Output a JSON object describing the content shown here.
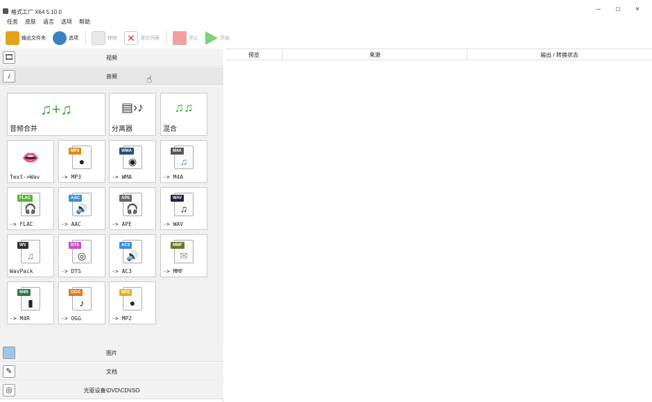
{
  "window": {
    "title": "格式工厂 X64 5.10.0",
    "controls": {
      "minimize": "–",
      "maximize": "□",
      "close": "×"
    }
  },
  "menu": [
    "任务",
    "皮肤",
    "语言",
    "选项",
    "帮助"
  ],
  "toolbar": {
    "output_folder": "输出文件夹",
    "options": "选项",
    "remove": "移除",
    "clear_list": "清空列表",
    "stop": "停止",
    "start": "开始"
  },
  "categories": {
    "video": "视频",
    "audio": "音频",
    "image": "图片",
    "document": "文档",
    "disc": "光驱设备\\DVD\\CD\\ISO"
  },
  "audio_tools": {
    "big": [
      {
        "label": "音频合并",
        "icon": "audio-merge-icon"
      },
      {
        "label": "分离器",
        "icon": "splitter-icon"
      },
      {
        "label": "混合",
        "icon": "mix-icon"
      }
    ],
    "rows": [
      [
        {
          "label": "Text->Wav",
          "badge": ""
        },
        {
          "label": "-> MP3",
          "badge": "MP3"
        },
        {
          "label": "-> WMA",
          "badge": "WMA"
        },
        {
          "label": "-> M4A",
          "badge": "M4A"
        }
      ],
      [
        {
          "label": "-> FLAC",
          "badge": "FLAC"
        },
        {
          "label": "-> AAC",
          "badge": "AAC"
        },
        {
          "label": "-> APE",
          "badge": "APE"
        },
        {
          "label": "-> WAV",
          "badge": "WAV"
        }
      ],
      [
        {
          "label": "WavPack",
          "badge": "WV"
        },
        {
          "label": "-> DTS",
          "badge": "DTS"
        },
        {
          "label": "-> AC3",
          "badge": "AC3"
        },
        {
          "label": "-> MMF",
          "badge": "MMF"
        }
      ],
      [
        {
          "label": "-> M4R",
          "badge": "M4R"
        },
        {
          "label": "-> OGG",
          "badge": "OGG"
        },
        {
          "label": "-> MP2",
          "badge": "MP2"
        }
      ]
    ],
    "badge_colors": {
      "MP3": "#e08a1a",
      "WMA": "#2a4f7a",
      "M4A": "#555555",
      "FLAC": "#55b82e",
      "AAC": "#3b8fd8",
      "APE": "#666666",
      "WAV": "#222244",
      "WV": "#333333",
      "DTS": "#c94fc9",
      "AC3": "#3b8fd8",
      "MMF": "#6a7a2a",
      "M4R": "#2f7a4a",
      "OGG": "#e07b1a",
      "MP2": "#e0b21a"
    }
  },
  "task_list": {
    "columns": [
      "预览",
      "来源",
      "输出 / 转换状态"
    ]
  }
}
